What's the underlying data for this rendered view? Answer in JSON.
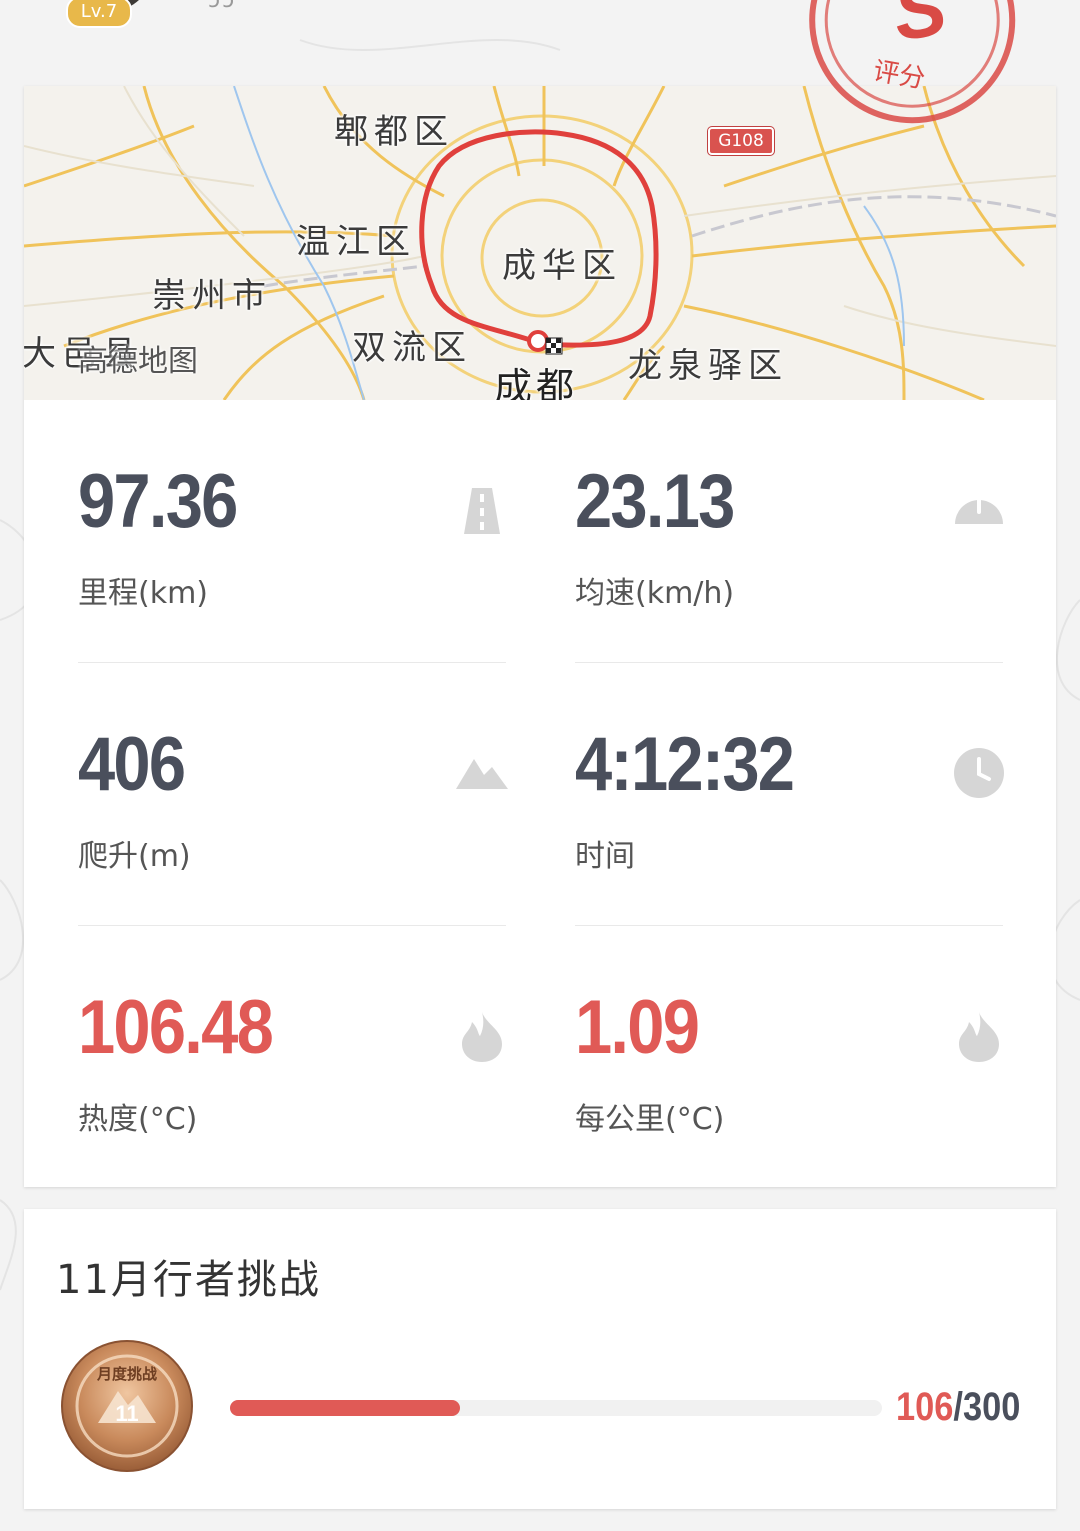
{
  "header": {
    "level_badge": "Lv.7",
    "username_partial": "ↄↄ"
  },
  "rating_stamp": {
    "grade": "S",
    "label": "评分",
    "color": "#d94a45"
  },
  "map": {
    "road_badge": "G108",
    "provider_logo": "高德地图",
    "labels": {
      "pidu": "郫都区",
      "wenjiang": "温江区",
      "chenghua": "成华区",
      "chongzhou": "崇州市",
      "dayi": "大邑县",
      "shuangliu": "双流区",
      "longquanyi": "龙泉驿区",
      "chengdu": "成都"
    },
    "route_color": "#e0403c"
  },
  "stats": {
    "distance": {
      "value": "97.36",
      "label": "里程(km)",
      "icon": "road-icon"
    },
    "avg_speed": {
      "value": "23.13",
      "label": "均速(km/h)",
      "icon": "speedometer-icon"
    },
    "climb": {
      "value": "406",
      "label": "爬升(m)",
      "icon": "mountain-icon"
    },
    "time": {
      "value": "4:12:32",
      "label": "时间",
      "icon": "clock-icon"
    },
    "heat": {
      "value": "106.48",
      "label": "热度(°C)",
      "icon": "flame-icon"
    },
    "heat_per_km": {
      "value": "1.09",
      "label": "每公里(°C)",
      "icon": "flame-icon"
    }
  },
  "challenge": {
    "title": "11月行者挑战",
    "medal_text": "月度挑战",
    "medal_month": "11",
    "current": "106",
    "separator": "/",
    "total": "300",
    "progress_fraction": 0.353
  },
  "colors": {
    "accent_red": "#e05a56",
    "value_gray": "#4a4f5c",
    "icon_gray": "#d6d6d6"
  }
}
